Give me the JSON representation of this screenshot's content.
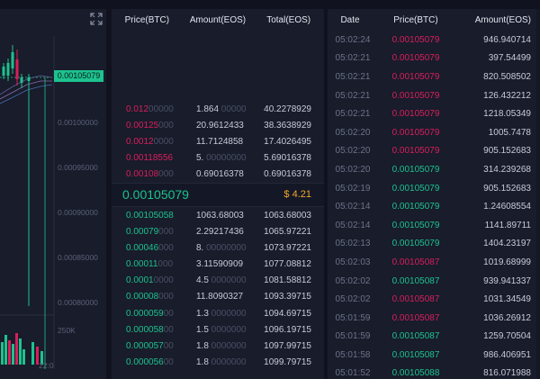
{
  "chart": {
    "last_price_tag": "0.00105079",
    "y_axis": [
      "0.00100000",
      "0.00095000",
      "0.00090000",
      "0.00085000",
      "0.00080000"
    ],
    "volume_label": "250K",
    "x_label": "22:0"
  },
  "order_book": {
    "headers": {
      "price": "Price(BTC)",
      "amount": "Amount(EOS)",
      "total": "Total(EOS)"
    },
    "asks": [
      {
        "price_main": "0.012",
        "price_dim": "00000",
        "amount_main": "1.864",
        "amount_dim": " 00000",
        "total": "40.2278929"
      },
      {
        "price_main": "0.00125",
        "price_dim": "000",
        "amount_main": "20.9612433",
        "amount_dim": "",
        "total": "38.3638929"
      },
      {
        "price_main": "0.0012",
        "price_dim": "0000",
        "amount_main": "11.7124858",
        "amount_dim": "",
        "total": "17.4026495"
      },
      {
        "price_main": "0.00118556",
        "price_dim": "",
        "amount_main": "5.",
        "amount_dim": " 00000000",
        "total": "5.69016378"
      },
      {
        "price_main": "0.00108",
        "price_dim": "000",
        "amount_main": "0.69016378",
        "amount_dim": "",
        "total": "0.69016378"
      }
    ],
    "last_price": "0.00105079",
    "last_price_usd": "$ 4.21",
    "bids": [
      {
        "price_main": "0.00105058",
        "price_dim": "",
        "amount_main": "1063.68003",
        "amount_dim": "",
        "total": "1063.68003"
      },
      {
        "price_main": "0.00079",
        "price_dim": "000",
        "amount_main": "2.29217436",
        "amount_dim": "",
        "total": "1065.97221"
      },
      {
        "price_main": "0.00046",
        "price_dim": "000",
        "amount_main": "8.",
        "amount_dim": " 00000000",
        "total": "1073.97221"
      },
      {
        "price_main": "0.00011",
        "price_dim": "000",
        "amount_main": "3.11590909",
        "amount_dim": "",
        "total": "1077.08812"
      },
      {
        "price_main": "0.0001",
        "price_dim": "0000",
        "amount_main": "4.5",
        "amount_dim": " 0000000",
        "total": "1081.58812"
      },
      {
        "price_main": "0.00008",
        "price_dim": "000",
        "amount_main": "11.8090327",
        "amount_dim": "",
        "total": "1093.39715"
      },
      {
        "price_main": "0.000059",
        "price_dim": "00",
        "amount_main": "1.3",
        "amount_dim": " 0000000",
        "total": "1094.69715"
      },
      {
        "price_main": "0.000058",
        "price_dim": "00",
        "amount_main": "1.5",
        "amount_dim": " 0000000",
        "total": "1096.19715"
      },
      {
        "price_main": "0.000057",
        "price_dim": "00",
        "amount_main": "1.8",
        "amount_dim": " 0000000",
        "total": "1097.99715"
      },
      {
        "price_main": "0.000056",
        "price_dim": "00",
        "amount_main": "1.8",
        "amount_dim": " 0000000",
        "total": "1099.79715"
      }
    ]
  },
  "trades": {
    "headers": {
      "date": "Date",
      "price": "Price(BTC)",
      "amount": "Amount(EOS)"
    },
    "rows": [
      {
        "time": "05:02:24",
        "price": "0.00105079",
        "side": "red",
        "amount": "946.940714"
      },
      {
        "time": "05:02:21",
        "price": "0.00105079",
        "side": "red",
        "amount": "397.54499"
      },
      {
        "time": "05:02:21",
        "price": "0.00105079",
        "side": "red",
        "amount": "820.508502"
      },
      {
        "time": "05:02:21",
        "price": "0.00105079",
        "side": "red",
        "amount": "126.432212"
      },
      {
        "time": "05:02:21",
        "price": "0.00105079",
        "side": "red",
        "amount": "1218.05349"
      },
      {
        "time": "05:02:20",
        "price": "0.00105079",
        "side": "red",
        "amount": "1005.7478"
      },
      {
        "time": "05:02:20",
        "price": "0.00105079",
        "side": "red",
        "amount": "905.152683"
      },
      {
        "time": "05:02:20",
        "price": "0.00105079",
        "side": "green",
        "amount": "314.239268"
      },
      {
        "time": "05:02:19",
        "price": "0.00105079",
        "side": "green",
        "amount": "905.152683"
      },
      {
        "time": "05:02:14",
        "price": "0.00105079",
        "side": "green",
        "amount": "1.24608554"
      },
      {
        "time": "05:02:14",
        "price": "0.00105079",
        "side": "green",
        "amount": "1141.89711"
      },
      {
        "time": "05:02:13",
        "price": "0.00105079",
        "side": "green",
        "amount": "1404.23197"
      },
      {
        "time": "05:02:03",
        "price": "0.00105087",
        "side": "red",
        "amount": "1019.68999"
      },
      {
        "time": "05:02:02",
        "price": "0.00105087",
        "side": "green",
        "amount": "939.941337"
      },
      {
        "time": "05:02:02",
        "price": "0.00105087",
        "side": "red",
        "amount": "1031.34549"
      },
      {
        "time": "05:01:59",
        "price": "0.00105087",
        "side": "red",
        "amount": "1036.26912"
      },
      {
        "time": "05:01:59",
        "price": "0.00105087",
        "side": "green",
        "amount": "1259.70504"
      },
      {
        "time": "05:01:58",
        "price": "0.00105087",
        "side": "green",
        "amount": "986.406951"
      },
      {
        "time": "05:01:52",
        "price": "0.00105088",
        "side": "green",
        "amount": "816.071988"
      }
    ]
  },
  "colors": {
    "ask": "#d81f5a",
    "bid": "#1dc28e",
    "usd": "#f0a72a"
  }
}
